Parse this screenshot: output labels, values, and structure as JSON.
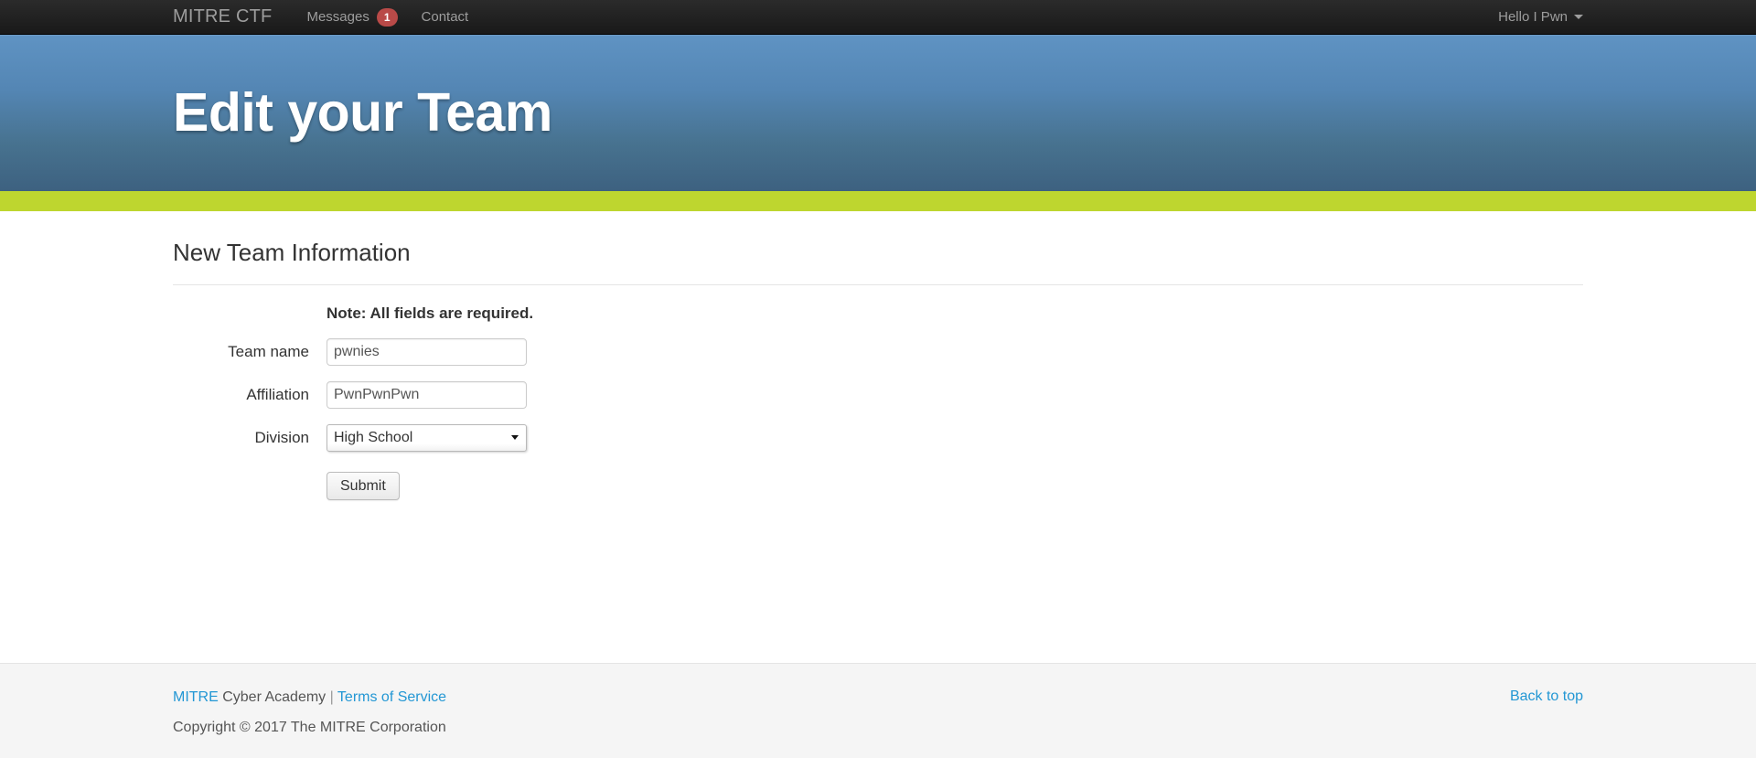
{
  "navbar": {
    "brand": "MITRE CTF",
    "items": [
      {
        "label": "Messages",
        "badge": "1"
      },
      {
        "label": "Contact",
        "badge": null
      }
    ],
    "user_menu": "Hello I Pwn"
  },
  "hero": {
    "title": "Edit your Team"
  },
  "main": {
    "section_title": "New Team Information",
    "note": "Note: All fields are required.",
    "fields": [
      {
        "label": "Team name",
        "value": "pwnies",
        "type": "text"
      },
      {
        "label": "Affiliation",
        "value": "PwnPwnPwn",
        "type": "text"
      },
      {
        "label": "Division",
        "value": "High School",
        "type": "select"
      }
    ],
    "submit_label": "Submit"
  },
  "footer": {
    "org_link": "MITRE",
    "org_text": " Cyber Academy ",
    "separator": "|",
    "terms_link": "Terms of Service",
    "copyright": "Copyright © 2017 The MITRE Corporation",
    "back_to_top": "Back to top"
  },
  "colors": {
    "navbar_bg": "#1f1f1f",
    "hero_top": "#5f93c3",
    "hero_bottom": "#3d6180",
    "divider": "#bed62f",
    "badge": "#b94a48",
    "link": "#2397d4",
    "footer_bg": "#f5f5f5"
  }
}
